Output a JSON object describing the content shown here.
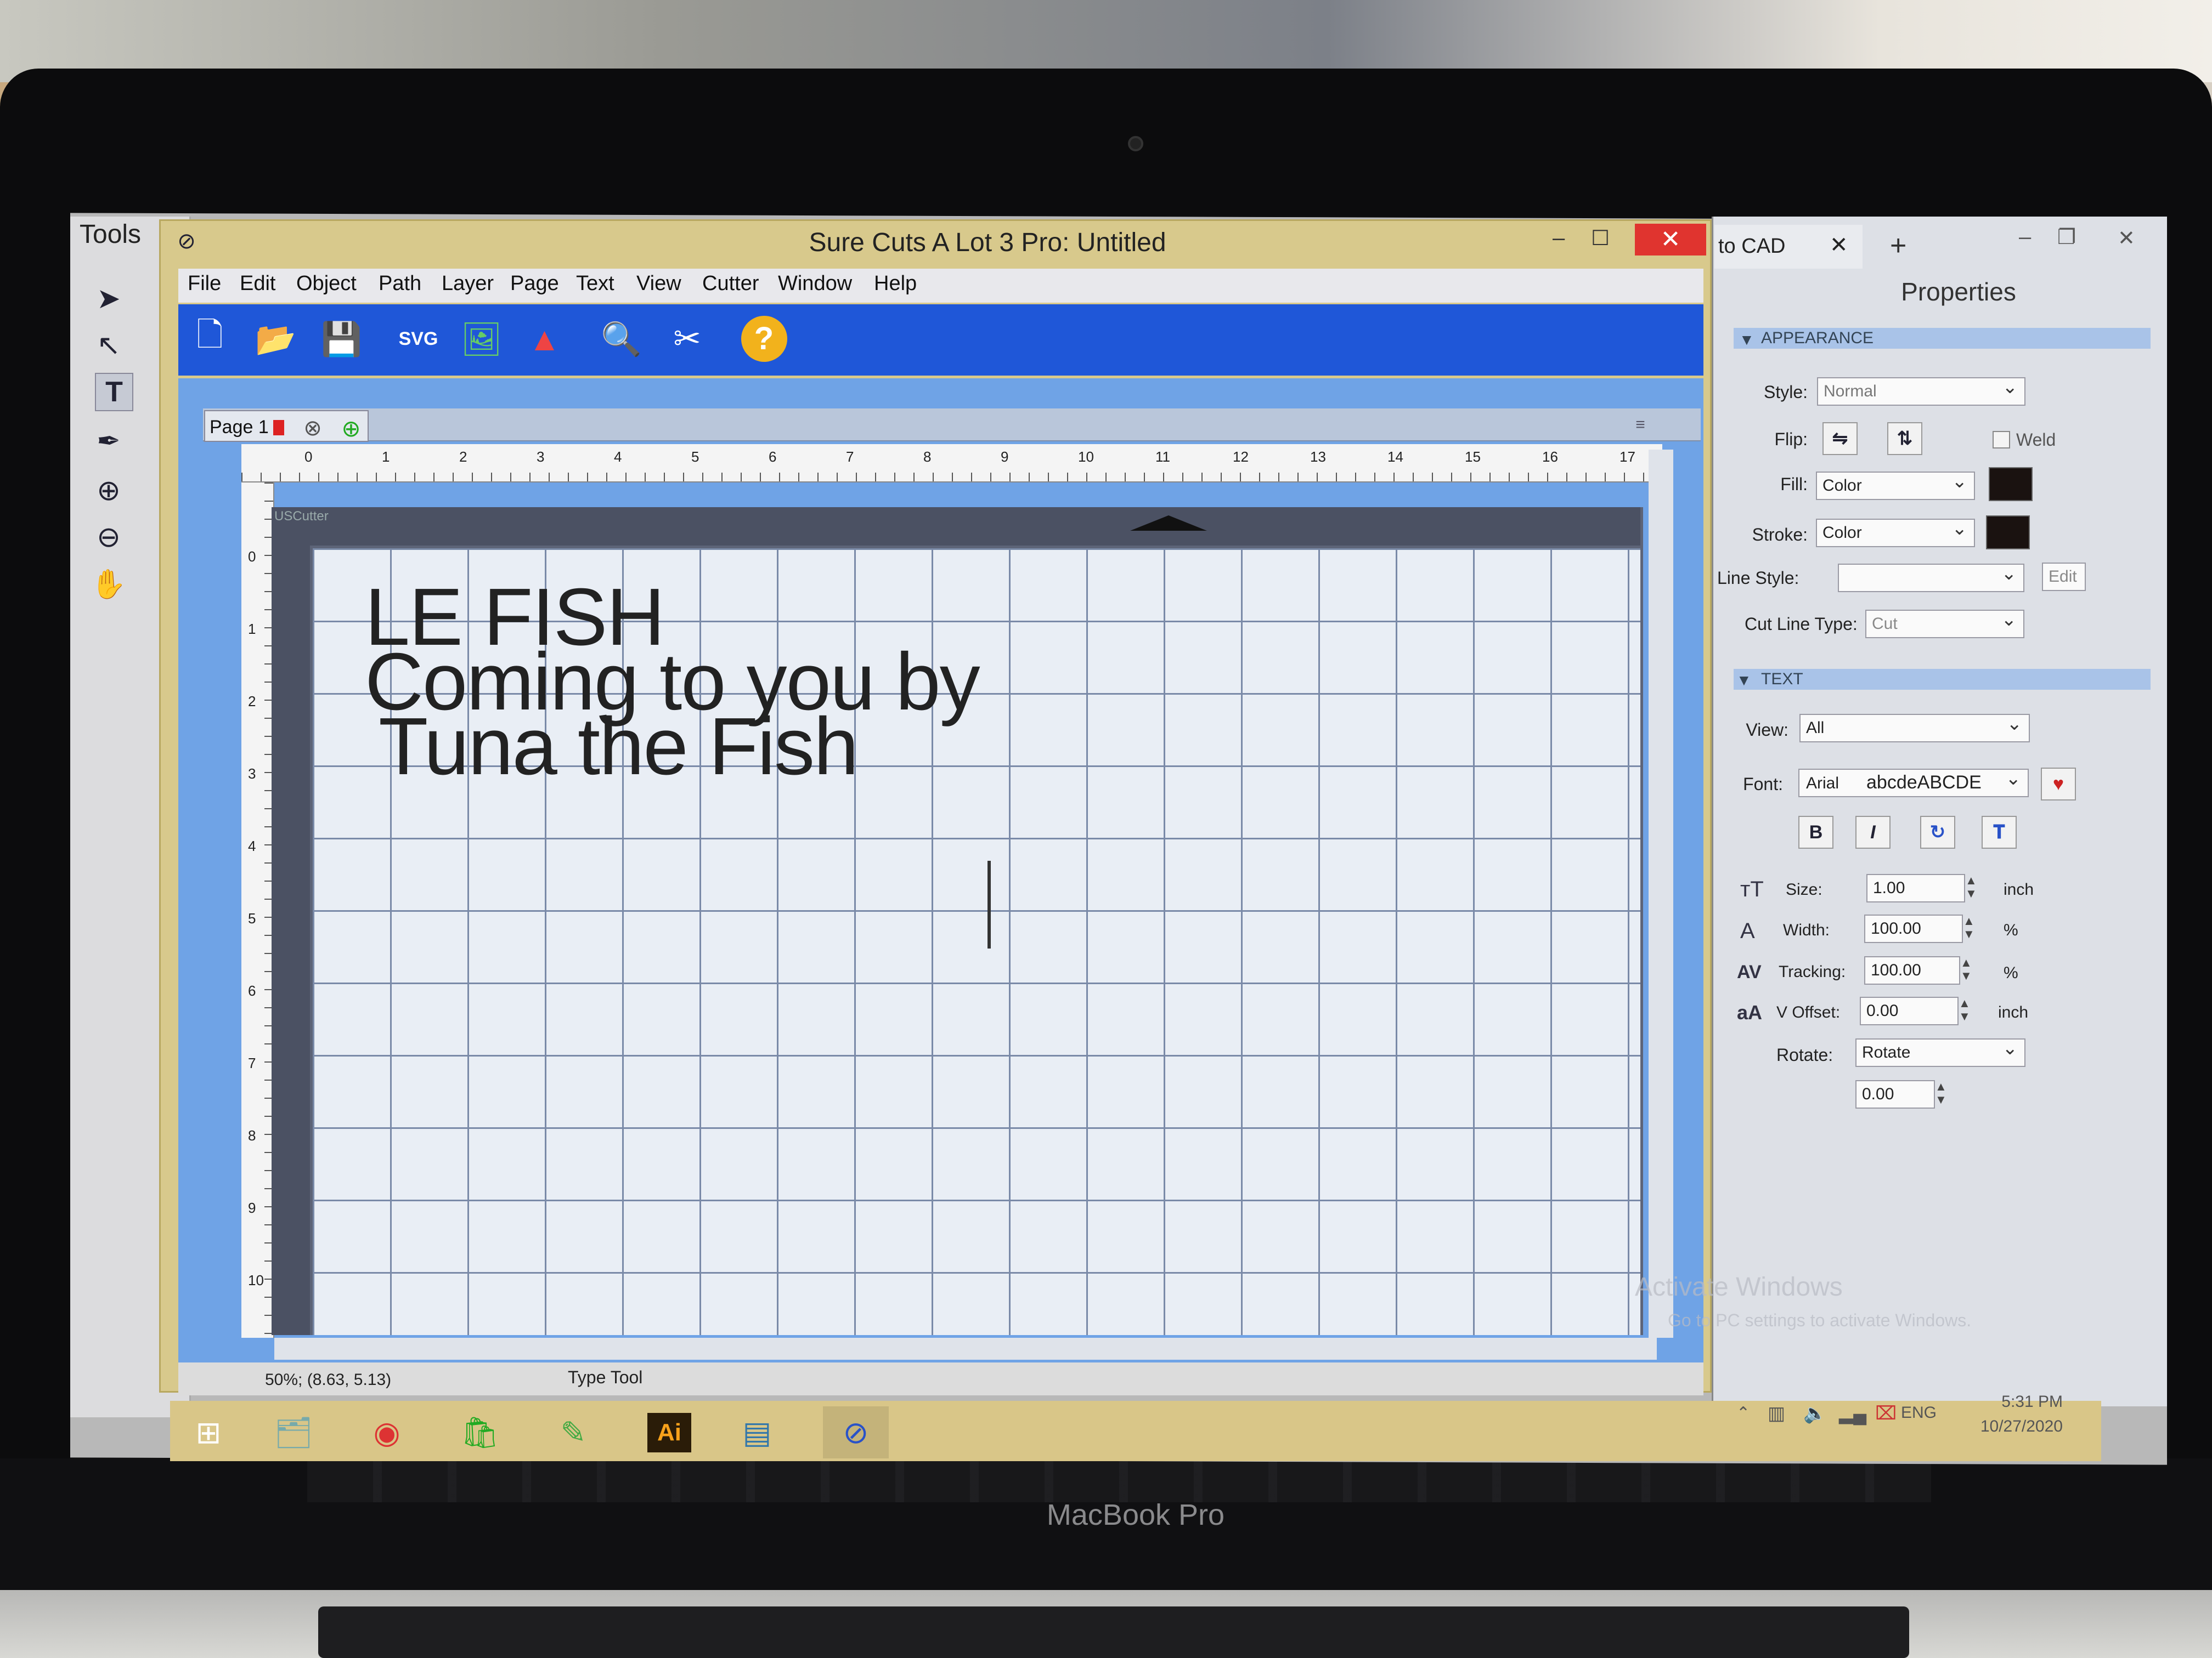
{
  "app": {
    "title": "Sure Cuts A Lot 3 Pro: Untitled",
    "tools_title": "Tools",
    "close_glyph": "✕",
    "max_glyph": "☐",
    "min_glyph": "–"
  },
  "menu": [
    "File",
    "Edit",
    "Object",
    "Path",
    "Layer",
    "Page",
    "Text",
    "View",
    "Cutter",
    "Window",
    "Help"
  ],
  "page_tab": {
    "label": "Page 1"
  },
  "ruler_top": [
    "0",
    "1",
    "2",
    "3",
    "4",
    "5",
    "6",
    "7",
    "8",
    "9",
    "10",
    "11",
    "12",
    "13",
    "14",
    "15",
    "16",
    "17"
  ],
  "ruler_left": [
    "0",
    "1",
    "2",
    "3",
    "4",
    "5",
    "6",
    "7",
    "8",
    "9",
    "10"
  ],
  "mat_label": "USCutter",
  "canvas_text": [
    "LE FISH",
    "Coming to you by",
    "Tuna the Fish"
  ],
  "status": {
    "coords": "50%; (8.63, 5.13)",
    "tool": "Type Tool"
  },
  "right_window": {
    "tab": "to CAD",
    "new_tab": "+"
  },
  "properties": {
    "title": "Properties",
    "appearance_header": "APPEARANCE",
    "style_label": "Style:",
    "style_value": "Normal",
    "flip_label": "Flip:",
    "weld_label": "Weld",
    "fill_label": "Fill:",
    "fill_value": "Color",
    "stroke_label": "Stroke:",
    "stroke_value": "Color",
    "line_style_label": "Line Style:",
    "edit_label": "Edit",
    "cut_line_label": "Cut Line Type:",
    "cut_line_value": "Cut",
    "text_header": "TEXT",
    "view_label": "View:",
    "view_value": "All",
    "font_label": "Font:",
    "font_value": "Arial",
    "font_preview": "abcdeABCDE",
    "bold": "B",
    "italic": "I",
    "size_label": "Size:",
    "size_value": "1.00",
    "size_unit": "inch",
    "width_label": "Width:",
    "width_value": "100.00",
    "width_unit": "%",
    "tracking_label": "Tracking:",
    "tracking_value": "100.00",
    "tracking_unit": "%",
    "voffset_label": "V Offset:",
    "voffset_value": "0.00",
    "voffset_unit": "inch",
    "rotate_label": "Rotate:",
    "rotate_value": "Rotate",
    "rotate_angle": "0.00"
  },
  "watermark": {
    "line1": "Activate Windows",
    "line2": "Go to PC settings to activate Windows."
  },
  "taskbar": {
    "time": "5:31 PM",
    "date": "10/27/2020",
    "lang": "ENG",
    "ai_label": "Ai"
  },
  "device_brand": "MacBook Pro",
  "colors": {
    "toolbar": "#1f57d8",
    "window_frame": "#d8c98c",
    "close_button": "#e0342f"
  }
}
